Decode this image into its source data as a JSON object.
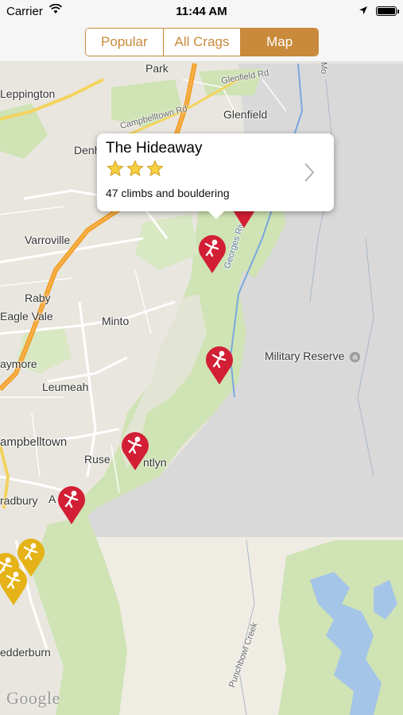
{
  "status_bar": {
    "carrier": "Carrier",
    "time": "11:44 AM"
  },
  "segmented": {
    "items": [
      {
        "label": "Popular",
        "active": false
      },
      {
        "label": "All Crags",
        "active": false
      },
      {
        "label": "Map",
        "active": true
      }
    ],
    "accent_color": "#c98a3c"
  },
  "callout": {
    "title": "The Hideaway",
    "stars": 3,
    "subtitle": "47 climbs and bouldering",
    "icon": "chevron-right-icon"
  },
  "map": {
    "labels": {
      "park": "Park",
      "leppington": "Leppington",
      "glenfield_rd": "Glenfield Rd",
      "glenfield": "Glenfield",
      "campbelltown_rd": "Campbelltown Rd",
      "denh": "Denh",
      "varroville": "Varroville",
      "raby": "Raby",
      "eagle_vale": "Eagle Vale",
      "minto": "Minto",
      "aymore": "aymore",
      "military_reserve": "Military Reserve",
      "leumeah": "Leumeah",
      "ampbelltown": "ampbelltown",
      "ruse": "Ruse",
      "ntlyn": "ntlyn",
      "radbury": "radbury",
      "a": "A",
      "edderburn": "edderburn",
      "punchbowl_creek": "Punchbowl Creek",
      "georges_river": "Georges River",
      "mo": "Mo"
    },
    "pin_colors": {
      "crag": "#d21f35",
      "boulder": "#e5b317"
    },
    "pin_icons": [
      "climber-icon"
    ],
    "attribution": "Google"
  }
}
